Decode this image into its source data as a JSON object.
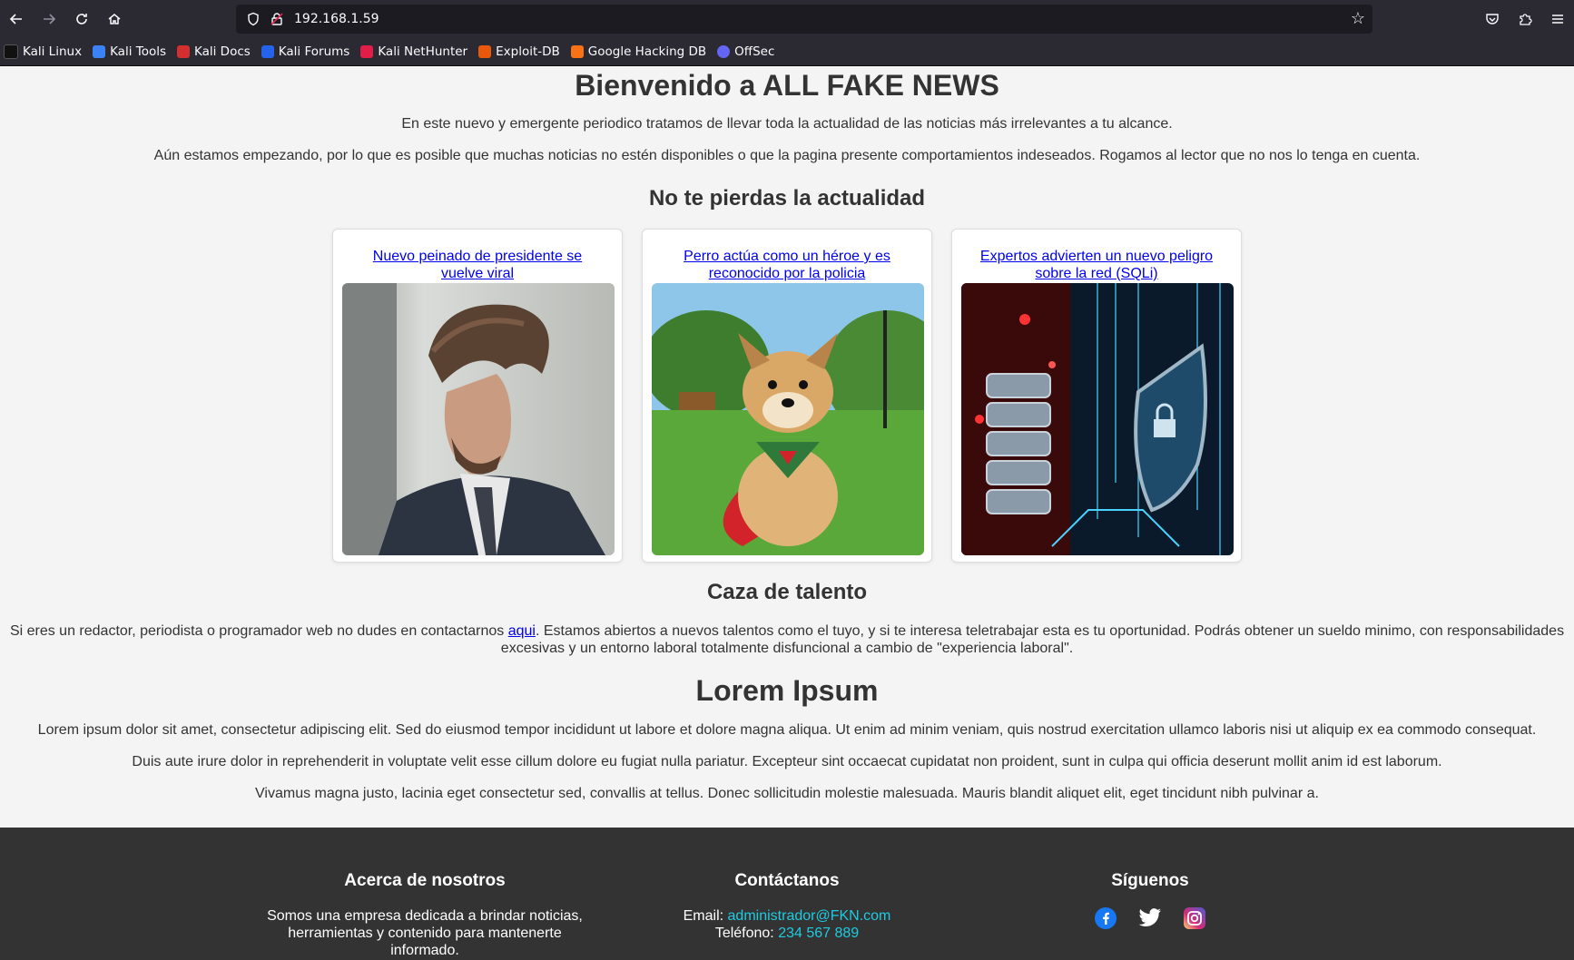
{
  "browser": {
    "url": "192.168.1.59",
    "bookmarks": [
      "Kali Linux",
      "Kali Tools",
      "Kali Docs",
      "Kali Forums",
      "Kali NetHunter",
      "Exploit-DB",
      "Google Hacking DB",
      "OffSec"
    ]
  },
  "header": {
    "title": "Bienvenido a ALL FAKE NEWS",
    "intro1": "En este nuevo y emergente periodico tratamos de llevar toda la actualidad de las noticias más irrelevantes a tu alcance.",
    "intro2": "Aún estamos empezando, por lo que es posible que muchas noticias no estén disponibles o que la pagina presente comportamientos indeseados. Rogamos al lector que no nos lo tenga en cuenta."
  },
  "news": {
    "heading": "No te pierdas la actualidad",
    "cards": [
      {
        "title": "Nuevo peinado de presidente se vuelve viral"
      },
      {
        "title": "Perro actúa como un héroe y es reconocido por la policia"
      },
      {
        "title": "Expertos advierten un nuevo peligro sobre la red (SQLi)"
      }
    ]
  },
  "talent": {
    "heading": "Caza de talento",
    "text_before": "Si eres un redactor, periodista o programador web no dudes en contactarnos ",
    "link": "aqui",
    "text_after": ". Estamos abiertos a nuevos talentos como el tuyo, y si te interesa teletrabajar esta es tu oportunidad. Podrás obtener un sueldo minimo, con responsabilidades excesivas y un entorno laboral totalmente disfuncional a cambio de \"experiencia laboral\"."
  },
  "lorem": {
    "heading": "Lorem Ipsum",
    "p1": "Lorem ipsum dolor sit amet, consectetur adipiscing elit. Sed do eiusmod tempor incididunt ut labore et dolore magna aliqua. Ut enim ad minim veniam, quis nostrud exercitation ullamco laboris nisi ut aliquip ex ea commodo consequat.",
    "p2": "Duis aute irure dolor in reprehenderit in voluptate velit esse cillum dolore eu fugiat nulla pariatur. Excepteur sint occaecat cupidatat non proident, sunt in culpa qui officia deserunt mollit anim id est laborum.",
    "p3": "Vivamus magna justo, lacinia eget consectetur sed, convallis at tellus. Donec sollicitudin molestie malesuada. Mauris blandit aliquet elit, eget tincidunt nibh pulvinar a."
  },
  "footer": {
    "about_heading": "Acerca de nosotros",
    "about_text": "Somos una empresa dedicada a brindar noticias, herramientas y contenido para mantenerte informado.",
    "contact_heading": "Contáctanos",
    "email_label": "Email: ",
    "email": "administrador@FKN.com",
    "phone_label": "Teléfono: ",
    "phone": "234 567 889",
    "follow_heading": "Síguenos"
  }
}
